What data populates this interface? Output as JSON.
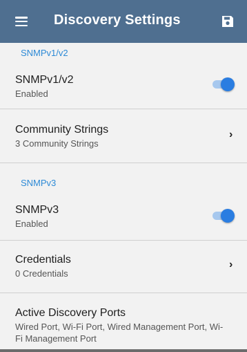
{
  "appbar": {
    "title": "Discovery Settings",
    "menu_icon": "hamburger-menu-icon",
    "save_icon": "save-floppy-icon",
    "bg_color": "#4f6f90"
  },
  "sections": {
    "snmpv1v2_header": "SNMPv1/v2",
    "snmpv3_header": "SNMPv3"
  },
  "rows": {
    "snmpv1v2": {
      "title": "SNMPv1/v2",
      "subtitle": "Enabled",
      "toggle_on": true
    },
    "community": {
      "title": "Community Strings",
      "subtitle": "3 Community Strings"
    },
    "snmpv3": {
      "title": "SNMPv3",
      "subtitle": "Enabled",
      "toggle_on": true
    },
    "credentials": {
      "title": "Credentials",
      "subtitle": "0 Credentials"
    },
    "ports": {
      "title": "Active Discovery Ports",
      "subtitle": "Wired Port, Wi-Fi Port, Wired Management Port, Wi-Fi Management Port"
    }
  },
  "colors": {
    "accent": "#2a7de1",
    "section_header": "#2d8ad6",
    "background": "#f2f2f2"
  }
}
